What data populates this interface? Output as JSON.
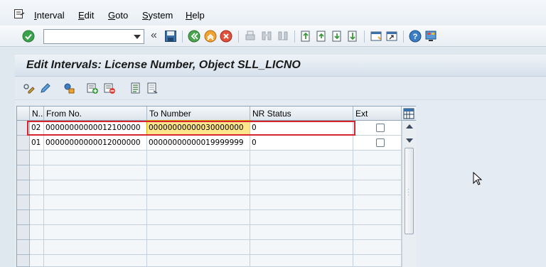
{
  "menu": {
    "items": [
      "Interval",
      "Edit",
      "Goto",
      "System",
      "Help"
    ]
  },
  "toolbar": {
    "command_value": "",
    "more_label": "«"
  },
  "title": "Edit Intervals: License Number, Object SLL_LICNO",
  "grid": {
    "columns": [
      "N..",
      "From No.",
      "To Number",
      "NR Status",
      "Ext"
    ],
    "rows": [
      {
        "no": "02",
        "from": "00000000000012100000",
        "to": "00000000000030000000",
        "status": "0",
        "ext": false
      },
      {
        "no": "01",
        "from": "00000000000012000000",
        "to": "00000000000019999999",
        "status": "0",
        "ext": false
      }
    ]
  },
  "colors": {
    "highlight": "#fde58c",
    "annotation_box": "#d9232f"
  }
}
